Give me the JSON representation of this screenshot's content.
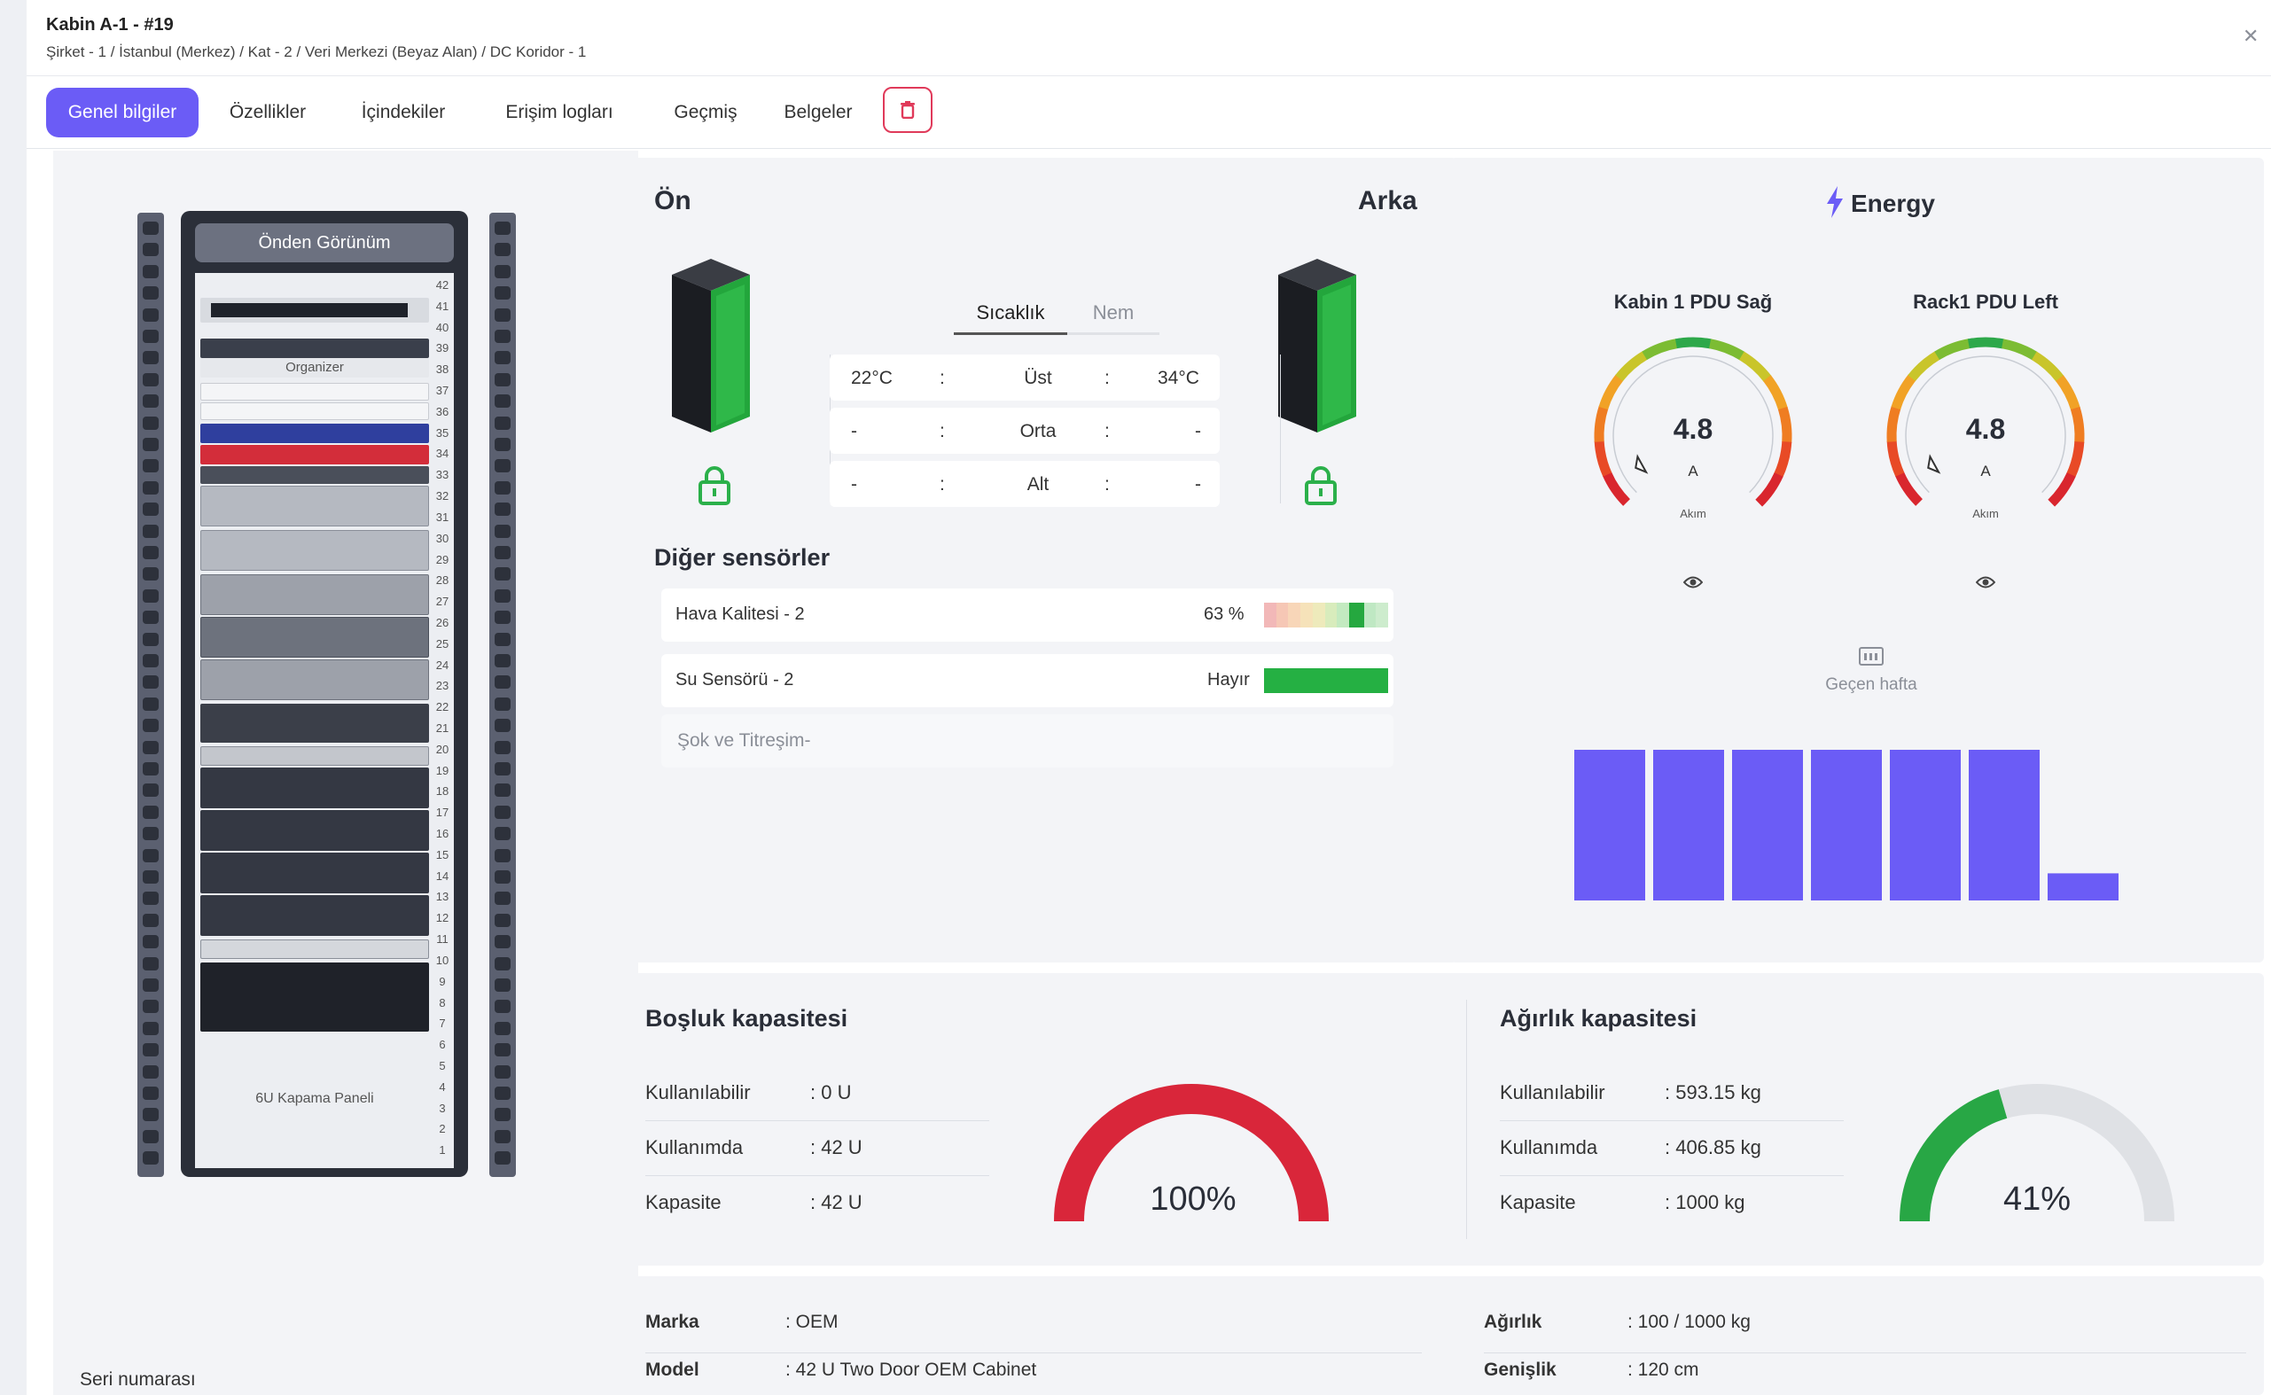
{
  "header": {
    "title": "Kabin A-1 - #19",
    "breadcrumb": "Şirket - 1 / İstanbul (Merkez) / Kat - 2 / Veri Merkezi (Beyaz Alan) / DC Koridor - 1",
    "close_icon": "close-icon"
  },
  "tabs": [
    {
      "label": "Genel bilgiler",
      "active": true
    },
    {
      "label": "Özellikler",
      "active": false
    },
    {
      "label": "İçindekiler",
      "active": false
    },
    {
      "label": "Erişim logları",
      "active": false
    },
    {
      "label": "Geçmiş",
      "active": false
    },
    {
      "label": "Belgeler",
      "active": false
    }
  ],
  "delete_icon": "trash-icon",
  "rack_view": {
    "title": "Önden Görünüm",
    "organizer_label": "Organizer",
    "blank_panel_label": "6U Kapama Paneli",
    "units": 42
  },
  "serial_label": "Seri numarası",
  "sensors": {
    "front_label": "Ön",
    "back_label": "Arka",
    "tab_temp": "Sıcaklık",
    "tab_humidity": "Nem",
    "rows": [
      {
        "front": "22°C",
        "sep": ":",
        "position": "Üst",
        "back": "34°C"
      },
      {
        "front": "-",
        "sep": ":",
        "position": "Orta",
        "back": "-"
      },
      {
        "front": "-",
        "sep": ":",
        "position": "Alt",
        "back": "-"
      }
    ],
    "other_title": "Diğer sensörler",
    "air_quality": {
      "label": "Hava Kalitesi - 2",
      "value": "63 %"
    },
    "water": {
      "label": "Su Sensörü - 2",
      "value": "Hayır"
    },
    "shock": {
      "label": "Şok ve Titreşim-"
    }
  },
  "energy": {
    "title": "Energy",
    "gauges": [
      {
        "name": "Kabin 1 PDU Sağ",
        "value": "4.8",
        "unit": "A",
        "sub": "Akım"
      },
      {
        "name": "Rack1 PDU Left",
        "value": "4.8",
        "unit": "A",
        "sub": "Akım"
      }
    ],
    "week_label": "Geçen hafta",
    "week_values": [
      100,
      100,
      100,
      100,
      100,
      100,
      18
    ],
    "colors": {
      "bar": "#6b5cf6",
      "accent": "#6b5cf6"
    }
  },
  "space": {
    "title": "Boşluk kapasitesi",
    "rows": [
      {
        "label": "Kullanılabilir",
        "value": ": 0 U"
      },
      {
        "label": "Kullanımda",
        "value": ": 42 U"
      },
      {
        "label": "Kapasite",
        "value": ": 42 U"
      }
    ],
    "percent": "100%",
    "fraction": 1.0,
    "color": "#d9263a"
  },
  "weight": {
    "title": "Ağırlık kapasitesi",
    "rows": [
      {
        "label": "Kullanılabilir",
        "value": ": 593.15 kg"
      },
      {
        "label": "Kullanımda",
        "value": ": 406.85 kg"
      },
      {
        "label": "Kapasite",
        "value": ": 1000 kg"
      }
    ],
    "percent": "41%",
    "fraction": 0.41,
    "color": "#28a745"
  },
  "info": {
    "left": [
      {
        "label": "Marka",
        "value": ": OEM"
      },
      {
        "label": "Model",
        "value": ": 42 U Two Door OEM Cabinet"
      }
    ],
    "right": [
      {
        "label": "Ağırlık",
        "value": ": 100 / 1000 kg"
      },
      {
        "label": "Genişlik",
        "value": ": 120 cm"
      }
    ]
  }
}
